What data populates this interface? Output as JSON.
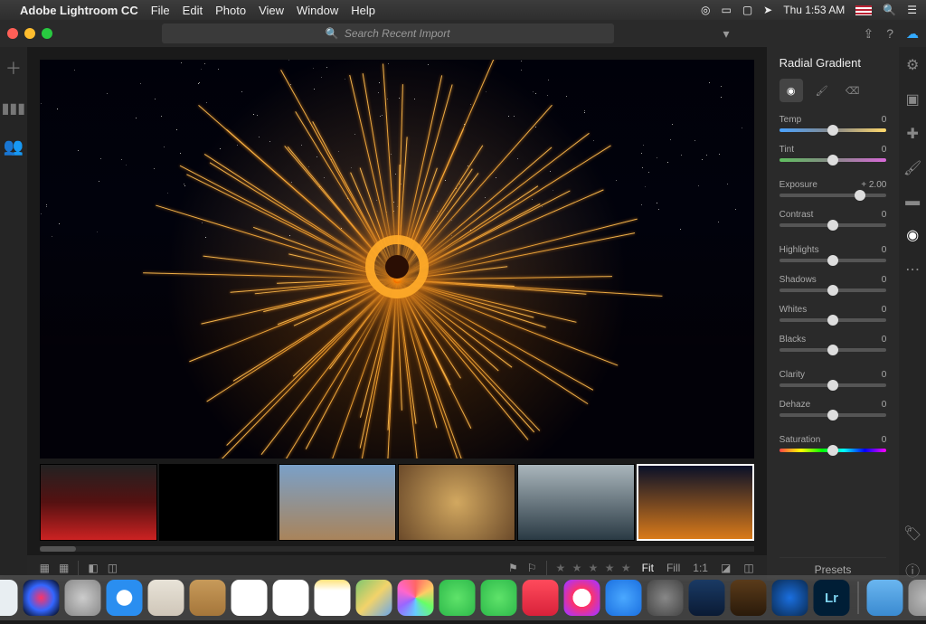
{
  "menubar": {
    "apple_icon": "apple-icon",
    "app_name": "Adobe Lightroom CC",
    "items": [
      "File",
      "Edit",
      "Photo",
      "View",
      "Window",
      "Help"
    ],
    "right": {
      "clock": "Thu 1:53 AM",
      "flag": "us-flag-icon",
      "search": "search-icon",
      "list": "list-icon"
    }
  },
  "window": {
    "search_placeholder": "Search Recent Import",
    "title_right_icons": [
      "filter-icon",
      "share-icon",
      "help-icon",
      "cloud-sync-icon"
    ]
  },
  "left_rail": {
    "icons": [
      "add-icon",
      "library-icon",
      "people-icon"
    ]
  },
  "panel": {
    "title": "Radial Gradient",
    "tools": [
      {
        "name": "radial-tool-icon",
        "active": true
      },
      {
        "name": "brush-tool-icon",
        "active": false
      },
      {
        "name": "erase-tool-icon",
        "active": false
      }
    ],
    "sliders": [
      {
        "label": "Temp",
        "value": "0",
        "pos": 50,
        "track": "temp"
      },
      {
        "label": "Tint",
        "value": "0",
        "pos": 50,
        "track": "tint"
      },
      {
        "label": "Exposure",
        "value": "+ 2.00",
        "pos": 75
      },
      {
        "label": "Contrast",
        "value": "0",
        "pos": 50
      },
      {
        "label": "Highlights",
        "value": "0",
        "pos": 50
      },
      {
        "label": "Shadows",
        "value": "0",
        "pos": 50
      },
      {
        "label": "Whites",
        "value": "0",
        "pos": 50
      },
      {
        "label": "Blacks",
        "value": "0",
        "pos": 50
      },
      {
        "label": "Clarity",
        "value": "0",
        "pos": 50
      },
      {
        "label": "Dehaze",
        "value": "0",
        "pos": 50
      },
      {
        "label": "Saturation",
        "value": "0",
        "pos": 50,
        "track": "sat"
      }
    ],
    "presets_label": "Presets"
  },
  "tool_rail": {
    "icons": [
      "edit-sliders-icon",
      "crop-icon",
      "healing-brush-icon",
      "brush-icon",
      "linear-gradient-icon",
      "radial-gradient-icon",
      "more-icon"
    ],
    "selected": "radial-gradient-icon",
    "bottom_icons": [
      "tag-icon",
      "info-icon"
    ]
  },
  "bottombar": {
    "view_icons": [
      "grid-small-icon",
      "grid-large-icon",
      "detail-icon",
      "square-icon"
    ],
    "flags": [
      "flag-pick-icon",
      "flag-reject-icon"
    ],
    "stars": "★ ★ ★ ★ ★",
    "fit": "Fit",
    "fill": "Fill",
    "one_to_one": "1:1",
    "right_icons": [
      "histogram-icon",
      "compare-icon"
    ]
  },
  "filmstrip": {
    "thumbs": [
      {
        "name": "thumb-1",
        "bg": "linear-gradient(#222,#511,#c22)"
      },
      {
        "name": "thumb-2",
        "bg": "#000"
      },
      {
        "name": "thumb-3",
        "bg": "linear-gradient(#7aa0c8,#a9845b)"
      },
      {
        "name": "thumb-4",
        "bg": "radial-gradient(circle,#d2a860,#6b4a2a)"
      },
      {
        "name": "thumb-5",
        "bg": "linear-gradient(#aab6bc,#2a3a44)"
      },
      {
        "name": "thumb-6",
        "bg": "linear-gradient(#091028,#d97a1a)",
        "selected": true
      }
    ]
  },
  "dock": {
    "icons": [
      {
        "name": "finder-icon",
        "bg": "linear-gradient(90deg,#2aa8f2 50%,#e8eef2 50%)"
      },
      {
        "name": "siri-icon",
        "bg": "radial-gradient(circle,#f36,#36f,#000)"
      },
      {
        "name": "launchpad-icon",
        "bg": "radial-gradient(circle,#ccc,#888)"
      },
      {
        "name": "safari-icon",
        "bg": "radial-gradient(circle,#fff 30%,#2a8ef0 32%)"
      },
      {
        "name": "mail-icon",
        "bg": "linear-gradient(#e8e3d8,#cfc6b8)"
      },
      {
        "name": "contacts-icon",
        "bg": "linear-gradient(#c79a5a,#a5763a)"
      },
      {
        "name": "calendar-icon",
        "bg": "linear-gradient(#fff 30%,#fff 30%),linear-gradient(#e84a3a,#e84a3a)"
      },
      {
        "name": "reminders-icon",
        "bg": "#fff"
      },
      {
        "name": "notes-icon",
        "bg": "linear-gradient(#ffe37a,#fff 30%)"
      },
      {
        "name": "maps-icon",
        "bg": "linear-gradient(135deg,#7fc66f,#f2d36a,#6aa7ea)"
      },
      {
        "name": "photos-icon",
        "bg": "conic-gradient(#f66,#fc6,#6f6,#6cf,#96f,#f6c,#f66)"
      },
      {
        "name": "messages-icon",
        "bg": "radial-gradient(circle,#5fe36a,#2db94a)"
      },
      {
        "name": "facetime-icon",
        "bg": "radial-gradient(circle,#5fe36a,#2db94a)"
      },
      {
        "name": "news-icon",
        "bg": "linear-gradient(#ff4b5c,#d8213a)"
      },
      {
        "name": "itunes-icon",
        "bg": "radial-gradient(circle,#fff 35%,#f36 36%,#a3f 90%)"
      },
      {
        "name": "appstore-icon",
        "bg": "radial-gradient(circle,#4aa8ff,#1a6fe0)"
      },
      {
        "name": "settings-icon",
        "bg": "radial-gradient(circle,#888,#444)"
      },
      {
        "name": "magnet-icon",
        "bg": "linear-gradient(#1a3a64,#0a1a34)"
      },
      {
        "name": "imovie-icon",
        "bg": "linear-gradient(#5a3b1a,#2a1a0a)"
      },
      {
        "name": "1password-icon",
        "bg": "radial-gradient(circle,#1a6fe0,#0a2a50)"
      },
      {
        "name": "lightroom-icon",
        "bg": "#001e36"
      }
    ],
    "after_divider": [
      {
        "name": "folder-icon",
        "bg": "linear-gradient(#6ab6f0,#3a8ad0)"
      },
      {
        "name": "trash-icon",
        "bg": "radial-gradient(circle,#bbb,#888)"
      }
    ]
  }
}
